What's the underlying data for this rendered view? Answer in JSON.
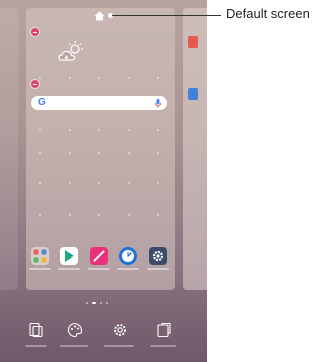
{
  "callout": {
    "label": "Default screen"
  },
  "search": {
    "logo": "G"
  },
  "icons": [
    "home-icon",
    "weather-icon",
    "mic-icon",
    "qslide-icon",
    "play-store-icon",
    "pen-icon",
    "clock-icon",
    "gear-icon",
    "widgets-icon",
    "theme-icon",
    "settings-icon",
    "wallpaper-icon"
  ],
  "dock": [
    "apps-folder",
    "play-store",
    "pen",
    "clock",
    "settings"
  ],
  "page_indicator": {
    "pages": 4,
    "current": 2
  },
  "colors": {
    "remove_badge": "#e0436b",
    "wallpaper_top": "#b6a39f",
    "wallpaper_bottom": "#6f586a",
    "play_store": "#0b8fd6",
    "pen": "#e9307a",
    "clock": "#1f73d1",
    "settings": "#3b4c6b"
  }
}
